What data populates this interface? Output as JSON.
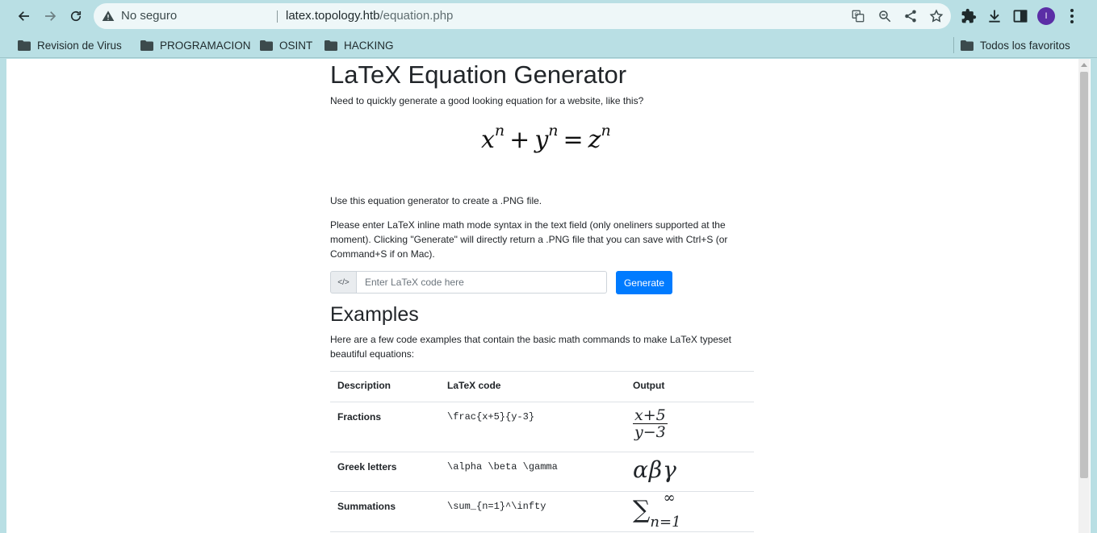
{
  "browser": {
    "security_label": "No seguro",
    "url_host": "latex.topology.htb",
    "url_path": "/equation.php",
    "profile_initial": "I",
    "bookmarks": [
      {
        "label": "Revision de Virus"
      },
      {
        "label": "PROGRAMACION"
      },
      {
        "label": "OSINT"
      },
      {
        "label": "HACKING"
      }
    ],
    "all_bookmarks_label": "Todos los favoritos"
  },
  "page": {
    "title": "LaTeX Equation Generator",
    "intro": "Need to quickly generate a good looking equation for a website, like this?",
    "hero": {
      "x": "x",
      "y": "y",
      "z": "z",
      "exp": "n",
      "plus": "+",
      "eq": "="
    },
    "use_text": "Use this equation generator to create a .PNG file.",
    "instructions": "Please enter LaTeX inline math mode syntax in the text field (only oneliners supported at the moment). Clicking \"Generate\" will directly return a .PNG file that you can save with Ctrl+S (or Command+S if on Mac).",
    "input_placeholder": "Enter LaTeX code here",
    "input_value": "",
    "generate_label": "Generate",
    "examples_title": "Examples",
    "examples_desc": "Here are a few code examples that contain the basic math commands to make LaTeX typeset beautiful equations:",
    "table": {
      "headers": [
        "Description",
        "LaTeX code",
        "Output"
      ],
      "rows": [
        {
          "description": "Fractions",
          "code": "\\frac{x+5}{y-3}",
          "output_num": "x+5",
          "output_den": "y−3"
        },
        {
          "description": "Greek letters",
          "code": "\\alpha \\beta \\gamma",
          "output": "αβγ"
        },
        {
          "description": "Summations",
          "code": "\\sum_{n=1}^\\infty",
          "output_symbol": "∑",
          "output_sub": "n=1",
          "output_sup": "∞"
        }
      ]
    }
  }
}
